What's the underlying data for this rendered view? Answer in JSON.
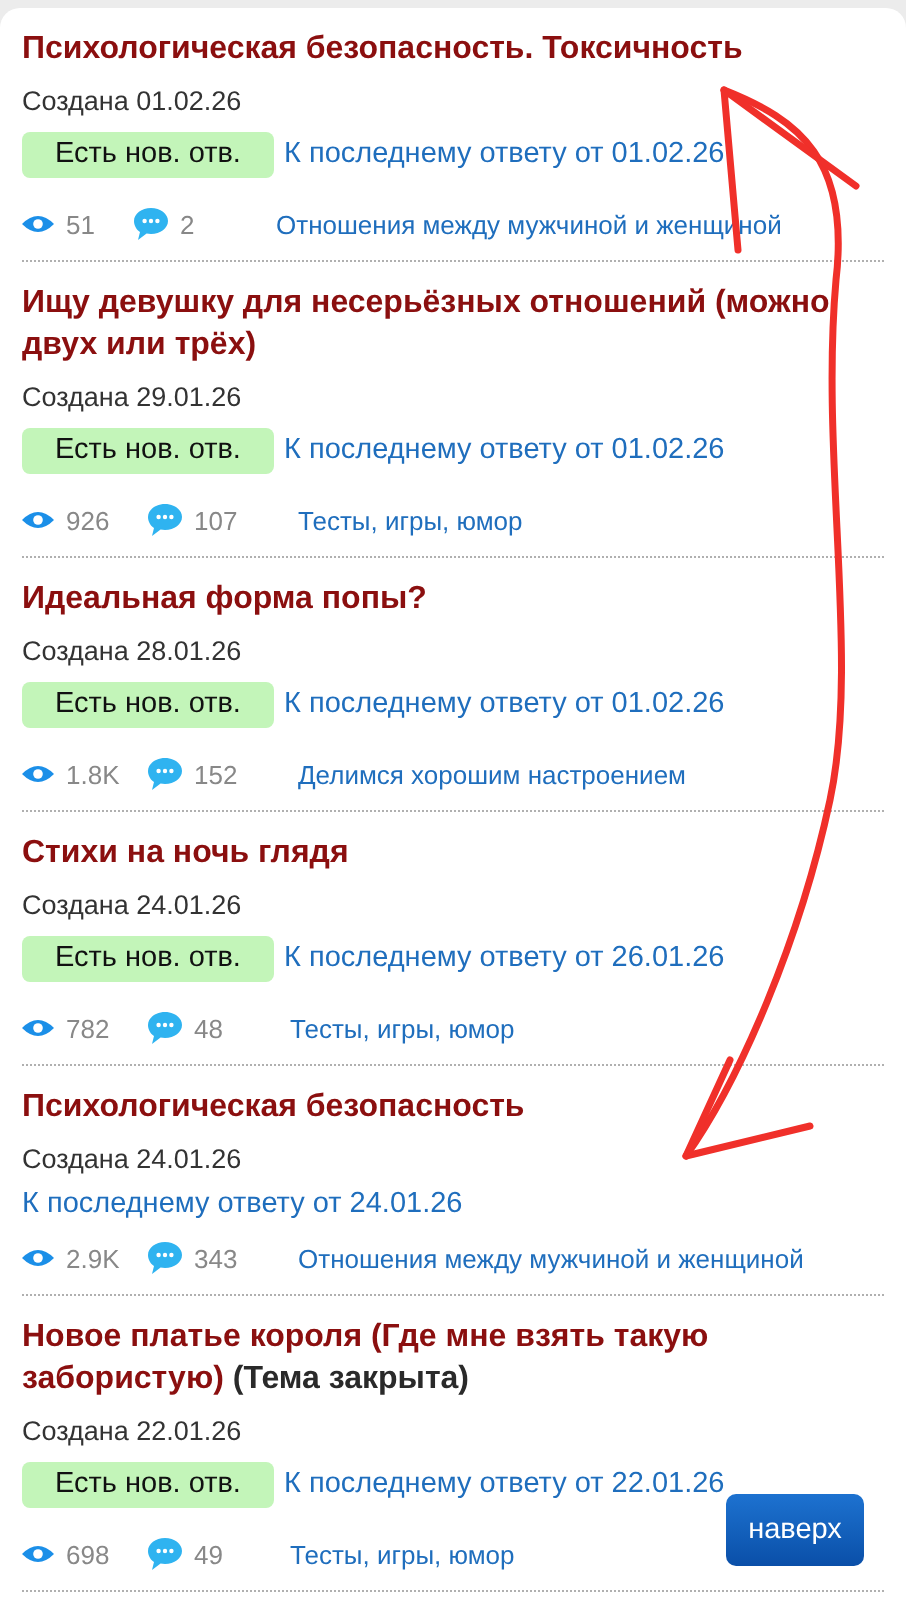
{
  "topics": [
    {
      "title": "Психологическая безопасность. Токсичность",
      "created": "Создана 01.02.26",
      "new_replies": true,
      "badge": "Есть нов. отв.",
      "last_reply": "К последнему ответу от 01.02.26",
      "views": "51",
      "comments": "2",
      "category": "Отношения между мужчиной и женщиной"
    },
    {
      "title": "Ищу девушку для несерьёзных отношений (можно двух или трёх)",
      "created": "Создана 29.01.26",
      "new_replies": true,
      "badge": "Есть нов. отв.",
      "last_reply": "К последнему ответу от 01.02.26",
      "views": "926",
      "comments": "107",
      "category": "Тесты, игры, юмор"
    },
    {
      "title": "Идеальная форма попы?",
      "created": "Создана 28.01.26",
      "new_replies": true,
      "badge": "Есть нов. отв.",
      "last_reply": "К последнему ответу от 01.02.26",
      "views": "1.8K",
      "comments": "152",
      "category": "Делимся хорошим настроением"
    },
    {
      "title": "Стихи на ночь глядя",
      "created": "Создана 24.01.26",
      "new_replies": true,
      "badge": "Есть нов. отв.",
      "last_reply": "К последнему ответу от 26.01.26",
      "views": "782",
      "comments": "48",
      "category": "Тесты, игры, юмор"
    },
    {
      "title": "Психологическая безопасность",
      "created": "Создана 24.01.26",
      "new_replies": false,
      "last_reply": "К последнему ответу от 24.01.26",
      "views": "2.9K",
      "comments": "343",
      "category": "Отношения между мужчиной и женщиной"
    },
    {
      "title": "Новое платье короля (Где мне взять такую забористую)",
      "closed_label": "(Тема закрыта)",
      "created": "Создана 22.01.26",
      "new_replies": true,
      "badge": "Есть нов. отв.",
      "last_reply": "К последнему ответу от 22.01.26",
      "views": "698",
      "comments": "49",
      "category": "Тесты, игры, юмор"
    }
  ],
  "scroll_top_button": "наверх"
}
